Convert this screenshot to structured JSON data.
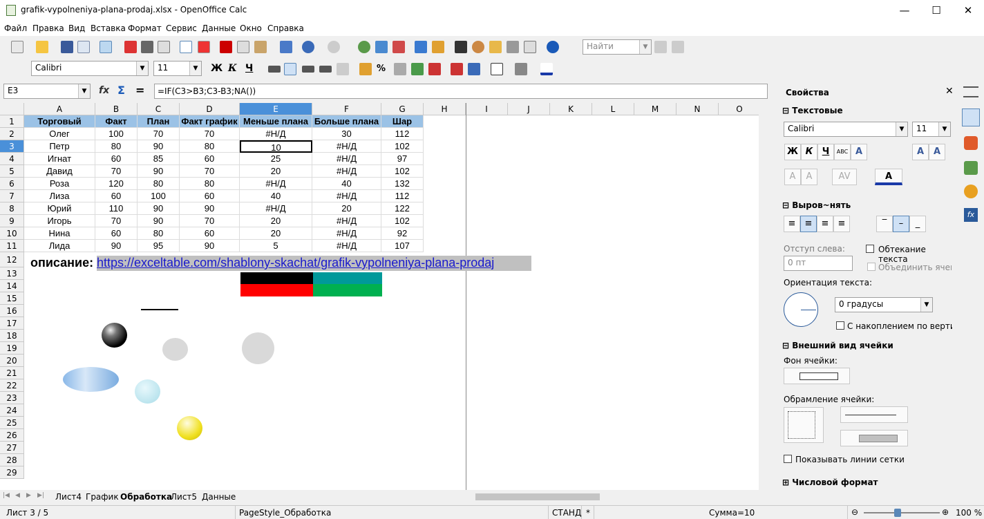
{
  "window": {
    "title": "grafik-vypolneniya-plana-prodaj.xlsx - OpenOffice Calc",
    "minimize": "—",
    "maximize": "☐",
    "close": "✕"
  },
  "menu": [
    "Файл",
    "Правка",
    "Вид",
    "Вставка",
    "Формат",
    "Сервис",
    "Данные",
    "Окно",
    "Справка"
  ],
  "toolbar": {
    "find_placeholder": "Найти",
    "font": "Calibri",
    "size": "11",
    "bold": "Ж",
    "italic": "К",
    "underline": "Ч",
    "percent": "%"
  },
  "formula": {
    "cellref": "E3",
    "content": "=IF(C3>B3;C3-B3;NA())",
    "fx": "fx",
    "sum": "Σ",
    "eq": "="
  },
  "columns": [
    "A",
    "B",
    "C",
    "D",
    "E",
    "F",
    "G",
    "H",
    "I",
    "J",
    "K",
    "L",
    "M",
    "N",
    "O"
  ],
  "rows": [
    "1",
    "2",
    "3",
    "4",
    "5",
    "6",
    "7",
    "8",
    "9",
    "10",
    "11",
    "12",
    "13",
    "14",
    "15",
    "16",
    "17",
    "18",
    "19",
    "20",
    "21",
    "22",
    "23",
    "24",
    "25",
    "26",
    "27",
    "28",
    "29"
  ],
  "table": {
    "headers": [
      "Торговый",
      "Факт",
      "План",
      "Факт график",
      "Меньше плана",
      "Больше плана",
      "Шар"
    ],
    "data": [
      [
        "Олег",
        "100",
        "70",
        "70",
        "#Н/Д",
        "30",
        "112"
      ],
      [
        "Петр",
        "80",
        "90",
        "80",
        "10",
        "#Н/Д",
        "102"
      ],
      [
        "Игнат",
        "60",
        "85",
        "60",
        "25",
        "#Н/Д",
        "97"
      ],
      [
        "Давид",
        "70",
        "90",
        "70",
        "20",
        "#Н/Д",
        "102"
      ],
      [
        "Роза",
        "120",
        "80",
        "80",
        "#Н/Д",
        "40",
        "132"
      ],
      [
        "Лиза",
        "60",
        "100",
        "60",
        "40",
        "#Н/Д",
        "112"
      ],
      [
        "Юрий",
        "110",
        "90",
        "90",
        "#Н/Д",
        "20",
        "122"
      ],
      [
        "Игорь",
        "70",
        "90",
        "70",
        "20",
        "#Н/Д",
        "102"
      ],
      [
        "Нина",
        "60",
        "80",
        "60",
        "20",
        "#Н/Д",
        "92"
      ],
      [
        "Лида",
        "90",
        "95",
        "90",
        "5",
        "#Н/Д",
        "107"
      ]
    ]
  },
  "description": {
    "label": "описание:",
    "link": "https://exceltable.com/shablony-skachat/grafik-vypolneniya-plana-prodaj"
  },
  "sheets": [
    "Лист4",
    "График",
    "Обработка",
    "Лист5",
    "Данные"
  ],
  "sidebar": {
    "title": "Свойства",
    "text_section": "Текстовые",
    "font": "Calibri",
    "size": "11",
    "align_section": "Выров~нять",
    "indent_label": "Отступ слева:",
    "indent_value": "0 пт",
    "wrap_label": "Обтекание текста",
    "merge_label": "Объединить ячейки",
    "orient_label": "Ориентация текста:",
    "orient_value": "0 градусы",
    "stack_label": "С накоплением по вертикали",
    "appearance_section": "Внешний вид ячейки",
    "bg_label": "Фон ячейки:",
    "border_label": "Обрамление ячейки:",
    "grid_label": "Показывать линии сетки",
    "number_section": "Числовой формат"
  },
  "status": {
    "sheet": "Лист 3 / 5",
    "style": "PageStyle_Обработка",
    "mode": "СТАНД",
    "modified": "*",
    "sum": "Сумма=10",
    "zoom": "100 %"
  }
}
